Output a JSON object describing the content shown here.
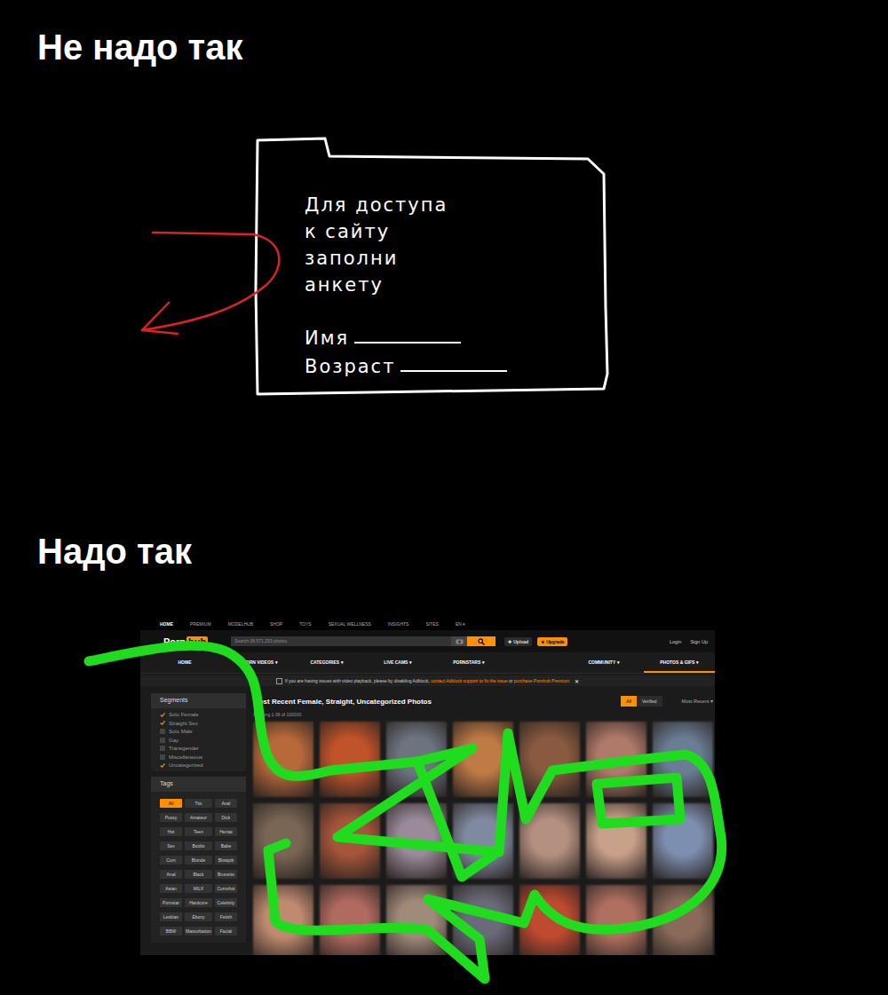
{
  "bad": {
    "heading": "Не надо так",
    "form": {
      "lines": [
        "Для доступа",
        "к сайту",
        "заполни",
        "анкету"
      ],
      "fields": [
        {
          "label": "Имя"
        },
        {
          "label": "Возраст"
        }
      ]
    }
  },
  "good": {
    "heading": "Надо так",
    "site": {
      "top_nav": [
        {
          "label": "HOME",
          "selected": true
        },
        {
          "label": "PREMIUM",
          "selected": false
        },
        {
          "label": "MODELHUB",
          "selected": false
        },
        {
          "label": "SHOP",
          "selected": false
        },
        {
          "label": "TOYS",
          "selected": false
        },
        {
          "label": "SEXUAL WELLNESS",
          "selected": false
        },
        {
          "label": "INSIGHTS",
          "selected": false
        },
        {
          "label": "SITES",
          "selected": false
        },
        {
          "label": "EN ▾",
          "selected": false
        }
      ],
      "logo": {
        "left": "Porn",
        "right": "hub"
      },
      "search": {
        "placeholder": "Search 38,571,253 photos"
      },
      "header_buttons": [
        {
          "icon": "✚",
          "label": "Upload",
          "kind": "dark"
        },
        {
          "icon": "★",
          "label": "Upgrade",
          "kind": "orange"
        }
      ],
      "account_links": [
        "Login",
        "Sign Up"
      ],
      "main_nav": [
        {
          "label": "HOME",
          "selected": false
        },
        {
          "label": "PORN VIDEOS ▾",
          "selected": false
        },
        {
          "label": "CATEGORIES ▾",
          "selected": false
        },
        {
          "label": "LIVE CAMS ▾",
          "selected": false
        },
        {
          "label": "PORNSTARS ▾",
          "selected": false
        },
        {
          "label": "COMMUNITY ▾",
          "selected": false
        },
        {
          "label": "PHOTOS & GIFS ▾",
          "selected": true
        }
      ],
      "notice": {
        "parts": [
          {
            "text": "If you are having issues with video playback, please by disabling Adblock, ",
            "link": false
          },
          {
            "text": "contact Adblock support to fix the issue",
            "link": true
          },
          {
            "text": " or ",
            "link": false
          },
          {
            "text": "purchase Pornhub Premium",
            "link": true
          }
        ],
        "close": "✕"
      },
      "segments": {
        "title": "Segments",
        "items": [
          {
            "label": "Solo Female",
            "checked": true
          },
          {
            "label": "Straight Sex",
            "checked": true
          },
          {
            "label": "Solo Male",
            "checked": false
          },
          {
            "label": "Gay",
            "checked": false
          },
          {
            "label": "Transgender",
            "checked": false
          },
          {
            "label": "Miscellaneous",
            "checked": false
          },
          {
            "label": "Uncategorized",
            "checked": true
          }
        ]
      },
      "tags": {
        "title": "Tags",
        "items": [
          {
            "label": "All",
            "selected": true
          },
          {
            "label": "Tits",
            "selected": false
          },
          {
            "label": "Anal",
            "selected": false
          },
          {
            "label": "Pussy",
            "selected": false
          },
          {
            "label": "Amateur",
            "selected": false
          },
          {
            "label": "Dick",
            "selected": false
          },
          {
            "label": "Hot",
            "selected": false
          },
          {
            "label": "Teen",
            "selected": false
          },
          {
            "label": "Hentai",
            "selected": false
          },
          {
            "label": "Sex",
            "selected": false
          },
          {
            "label": "Boobs",
            "selected": false
          },
          {
            "label": "Babe",
            "selected": false
          },
          {
            "label": "Cum",
            "selected": false
          },
          {
            "label": "Blonde",
            "selected": false
          },
          {
            "label": "Blowjob",
            "selected": false
          },
          {
            "label": "Anal",
            "selected": false
          },
          {
            "label": "Black",
            "selected": false
          },
          {
            "label": "Brunette",
            "selected": false
          },
          {
            "label": "Asian",
            "selected": false
          },
          {
            "label": "MILF",
            "selected": false
          },
          {
            "label": "Cumshot",
            "selected": false
          },
          {
            "label": "Pornstar",
            "selected": false
          },
          {
            "label": "Hardcore",
            "selected": false
          },
          {
            "label": "Celebrity",
            "selected": false
          },
          {
            "label": "Lesbian",
            "selected": false
          },
          {
            "label": "Ebony",
            "selected": false
          },
          {
            "label": "Fetish",
            "selected": false
          },
          {
            "label": "BBW",
            "selected": false
          },
          {
            "label": "Masturbation",
            "selected": false
          },
          {
            "label": "Facial",
            "selected": false
          }
        ]
      },
      "content": {
        "title": "Most Recent Female, Straight, Uncategorized Photos",
        "filters": [
          {
            "label": "All",
            "selected": true
          },
          {
            "label": "Verified",
            "selected": false
          }
        ],
        "sort": "Most Recent ▾",
        "count": "Showing 1-36 of 100000"
      },
      "photos": [
        {
          "color": "#b8693a"
        },
        {
          "color": "#c0532a"
        },
        {
          "color": "#6d7480"
        },
        {
          "color": "#c07a45"
        },
        {
          "color": "#8a5a40"
        },
        {
          "color": "#b07a6a"
        },
        {
          "color": "#6a7d95"
        },
        {
          "color": "#7a6655"
        },
        {
          "color": "#a5553a"
        },
        {
          "color": "#9a8a9a"
        },
        {
          "color": "#7f8aa0"
        },
        {
          "color": "#b49080"
        },
        {
          "color": "#c9a08a"
        },
        {
          "color": "#7d8fb0"
        },
        {
          "color": "#c08a70"
        },
        {
          "color": "#b06a60"
        },
        {
          "color": "#a08a7a"
        },
        {
          "color": "#6a6a7a"
        },
        {
          "color": "#c04a30"
        },
        {
          "color": "#b07060"
        },
        {
          "color": "#8a6a5a"
        }
      ]
    }
  }
}
